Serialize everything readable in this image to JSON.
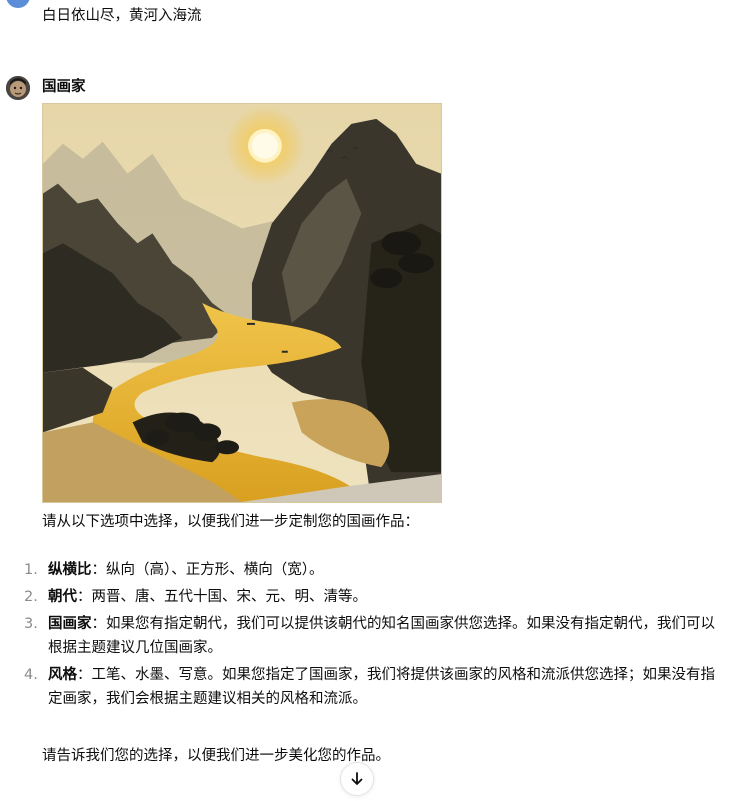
{
  "user_message": {
    "text": "白日依山尽，黄河入海流"
  },
  "assistant": {
    "name": "国画家",
    "image_alt": "Chinese ink landscape painting of mountains, golden sun and winding yellow river",
    "intro": "请从以下选项中选择，以便我们进一步定制您的国画作品：",
    "options": [
      {
        "num": "1.",
        "title": "纵横比",
        "text": "：纵向（高）、正方形、横向（宽）。"
      },
      {
        "num": "2.",
        "title": "朝代",
        "text": "：两晋、唐、五代十国、宋、元、明、清等。"
      },
      {
        "num": "3.",
        "title": "国画家",
        "text": "：如果您有指定朝代，我们可以提供该朝代的知名国画家供您选择。如果没有指定朝代，我们可以根据主题建议几位国画家。"
      },
      {
        "num": "4.",
        "title": "风格",
        "text": "：工笔、水墨、写意。如果您指定了国画家，我们将提供该画家的风格和流派供您选择；如果没有指定画家，我们会根据主题建议相关的风格和流派。"
      }
    ],
    "outro": "请告诉我们您的选择，以便我们进一步美化您的作品。"
  },
  "colors": {
    "sun": "#f5c431",
    "river": "#e9b128",
    "paper": "#e9dcb6",
    "ink": "#2b2a26"
  },
  "icons": {
    "scroll_down": "arrow-down-icon"
  }
}
